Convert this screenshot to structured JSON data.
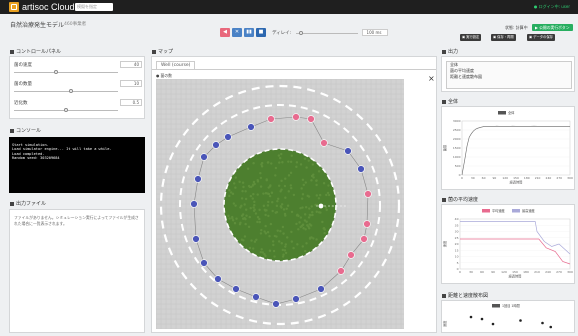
{
  "header": {
    "app_title": "artisoc Cloud",
    "project_placeholder": "模擬を指定",
    "user_text": "● ログイン中: user"
  },
  "model": {
    "title": "自然治療発生モデル",
    "subtitle": "460事業者"
  },
  "playback": {
    "reset_label": "◀",
    "step_label": "✕",
    "pause_label": "▮▮",
    "stop_label": "■",
    "delay_label": "ディレイ:",
    "delay_value": "100 ms",
    "delay_fraction": 0.08
  },
  "status": {
    "text": "状態: 計算中",
    "run_label": "▶ 公開の実行ボタン",
    "btn_settings": "▣ 実行設定",
    "btn_save": "▣ 保存・再開",
    "btn_more": "▣ データの保存"
  },
  "control_panel": {
    "title": "コントロールパネル",
    "params": [
      {
        "label": "菌の速度",
        "value": "40",
        "fraction": 0.4
      },
      {
        "label": "菌の数量",
        "value": "10",
        "fraction": 0.55
      },
      {
        "label": "近化数",
        "value": "0.5",
        "fraction": 0.5
      }
    ]
  },
  "console": {
    "title": "コンソール",
    "lines": [
      "",
      "Start simulation.",
      "Load simulator engine... It will take a while.",
      "Load completed.",
      "Random seed: 303209684"
    ]
  },
  "output_files": {
    "title": "出力ファイル",
    "text": "ファイルがありません。シミュレーション実行によってファイルが生成された場合に一覧表示されます。"
  },
  "map": {
    "title": "マップ",
    "tab": "Well (course)",
    "legend": "● 菌の数"
  },
  "outputs": {
    "title": "出力",
    "items": [
      "全体",
      "菌の平均速度",
      "距離と速度散布図"
    ],
    "close_label": "×"
  },
  "chart_data": [
    {
      "type": "line",
      "title": "全体",
      "legend": [
        "全体"
      ],
      "x": [
        0,
        8,
        14,
        20,
        26,
        32,
        38,
        44,
        52,
        62,
        72,
        84,
        96,
        110,
        125,
        140,
        160,
        180,
        200,
        220,
        240,
        260,
        280,
        300
      ],
      "y": [
        0,
        900,
        1600,
        2100,
        2300,
        2450,
        2550,
        2600,
        2650,
        2700,
        2700,
        2690,
        2710,
        2700,
        2690,
        2710,
        2700,
        2700,
        2710,
        2700,
        2690,
        2700,
        2700,
        2700
      ],
      "ylim": [
        0,
        3000
      ],
      "xlim": [
        0,
        300
      ],
      "xticks": [
        0,
        30,
        60,
        90,
        120,
        150,
        180,
        210,
        240,
        270,
        300
      ],
      "yticks": [
        0,
        500,
        1000,
        1500,
        2000,
        2500,
        3000
      ],
      "xlabel": "経過時間",
      "ylabel": "菌数"
    },
    {
      "type": "line",
      "title": "菌の平均速度",
      "legend": [
        "平均速度",
        "最高速度"
      ],
      "series": [
        {
          "name": "平均速度",
          "color": "#e86b8f",
          "x": [
            0,
            20,
            40,
            60,
            90,
            120,
            150,
            180,
            200,
            215,
            235,
            260,
            280,
            300
          ],
          "y": [
            24,
            24,
            24,
            24,
            24,
            24,
            24,
            24,
            24,
            24,
            17,
            14,
            6,
            4
          ]
        },
        {
          "name": "最高速度",
          "color": "#a9a9d9",
          "x": [
            0,
            20,
            60,
            100,
            140,
            180,
            205,
            210,
            230,
            250,
            270,
            300
          ],
          "y": [
            38,
            38,
            38,
            38,
            38,
            38,
            38,
            30,
            22,
            18,
            20,
            12
          ]
        }
      ],
      "ylim": [
        0,
        40
      ],
      "xlim": [
        0,
        300
      ],
      "xticks": [
        0,
        30,
        60,
        90,
        120,
        150,
        180,
        210,
        240,
        270,
        300
      ],
      "yticks": [
        0,
        5,
        10,
        15,
        20,
        25,
        30,
        35,
        40
      ],
      "xlabel": "経過時間",
      "ylabel": "速度"
    },
    {
      "type": "scatter",
      "title": "距離と速度散布図",
      "legend": [
        "1回目 1時間"
      ],
      "points": [
        [
          20,
          32
        ],
        [
          40,
          28
        ],
        [
          60,
          18
        ],
        [
          110,
          25
        ],
        [
          150,
          20
        ],
        [
          165,
          12
        ]
      ],
      "xlim": [
        0,
        200
      ],
      "ylim": [
        0,
        40
      ],
      "xlabel": "",
      "ylabel": "速度"
    }
  ],
  "colors": {
    "accent": "#e86b8f",
    "vehicle": "#4a55b8",
    "path": "#888888",
    "circle": "#ffffff",
    "hospital": "#4d7f2f"
  }
}
